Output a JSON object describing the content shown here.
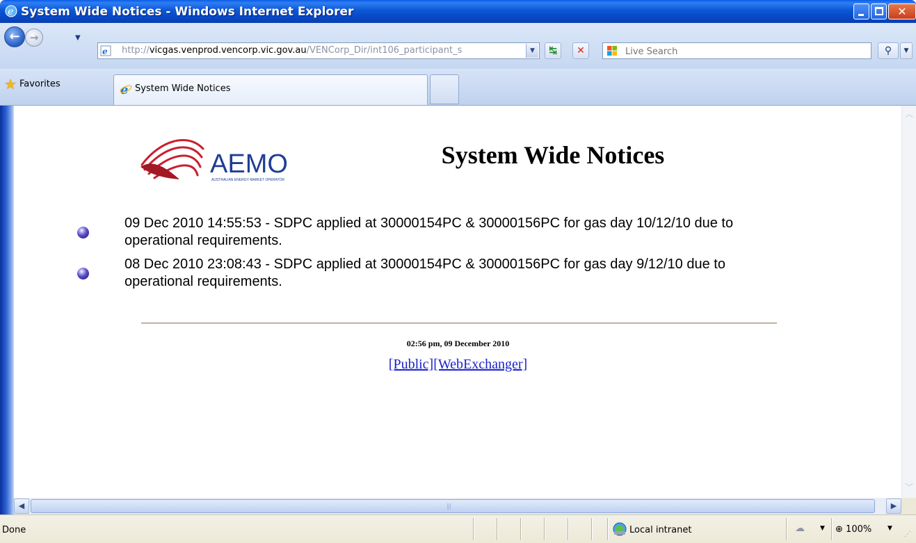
{
  "window": {
    "title": "System Wide Notices - Windows Internet Explorer"
  },
  "nav": {
    "address_prefix": "http://",
    "address_host": "vicgas.venprod.vencorp.vic.gov.au",
    "address_path": "/VENCorp_Dir/int106_participant_s",
    "search_placeholder": "Live Search"
  },
  "tabs": {
    "favorites_label": "Favorites",
    "active_tab_label": "System Wide Notices"
  },
  "page": {
    "logo_text": "AEMO",
    "logo_subtext": "AUSTRALIAN ENERGY MARKET OPERATOR",
    "heading": "System Wide Notices",
    "notices": [
      "09 Dec 2010 14:55:53 - SDPC applied at 30000154PC & 30000156PC for gas day 10/12/10 due to operational requirements.",
      "08 Dec 2010 23:08:43 - SDPC applied at 30000154PC & 30000156PC for gas day 9/12/10 due to operational requirements."
    ],
    "timestamp": "02:56 pm, 09 December 2010",
    "link_public": "[Public]",
    "link_webexchanger": "[WebExchanger]"
  },
  "statusbar": {
    "status": "Done",
    "zone": "Local intranet",
    "zoom": "100%"
  },
  "colors": {
    "titlebar": "#0c57d6",
    "link": "#1a22c9",
    "aemo_red": "#c8202e",
    "aemo_blue": "#1f3e94"
  },
  "icons": [
    "ie-icon",
    "back-icon",
    "forward-icon",
    "refresh-icon",
    "stop-icon",
    "live-search-icon",
    "search-icon",
    "favorites-star-icon",
    "intranet-zone-icon",
    "protected-mode-icon",
    "zoom-icon"
  ]
}
